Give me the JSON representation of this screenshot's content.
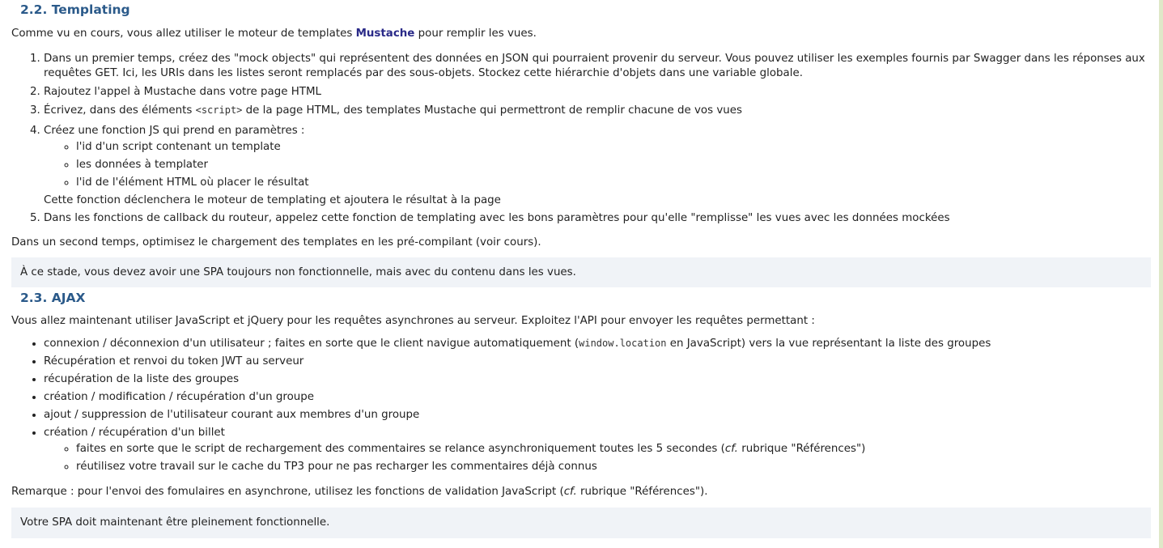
{
  "sec22": {
    "title": "2.2. Templating",
    "intro_before": "Comme vu en cours, vous allez utiliser le moteur de templates ",
    "intro_link": "Mustache",
    "intro_after": " pour remplir les vues.",
    "steps": {
      "s1": "Dans un premier temps, créez des \"mock objects\" qui représentent des données en JSON qui pourraient provenir du serveur. Vous pouvez utiliser les exemples fournis par Swagger dans les réponses aux requêtes GET. Ici, les URIs dans les listes seront remplacés par des sous-objets. Stockez cette hiérarchie d'objets dans une variable globale.",
      "s2": "Rajoutez l'appel à Mustache dans votre page HTML",
      "s3_before": "Écrivez, dans des éléments ",
      "s3_code": "<script>",
      "s3_after": " de la page HTML, des templates Mustache qui permettront de remplir chacune de vos vues",
      "s4": "Créez une fonction JS qui prend en paramètres :",
      "s4_sub": [
        "l'id d'un script contenant un template",
        "les données à templater",
        "l'id de l'élément HTML où placer le résultat"
      ],
      "s4_after": "Cette fonction déclenchera le moteur de templating et ajoutera le résultat à la page",
      "s5": "Dans les fonctions de callback du routeur, appelez cette fonction de templating avec les bons paramètres pour qu'elle \"remplisse\" les vues avec les données mockées"
    },
    "outro": "Dans un second temps, optimisez le chargement des templates en les pré-compilant (voir cours).",
    "note": "À ce stade, vous devez avoir une SPA toujours non fonctionnelle, mais avec du contenu dans les vues."
  },
  "sec23": {
    "title": "2.3. AJAX",
    "intro": "Vous allez maintenant utiliser JavaScript et jQuery pour les requêtes asynchrones au serveur. Exploitez l'API pour envoyer les requêtes permettant :",
    "items": {
      "i1_before": "connexion / déconnexion d'un utilisateur ; faites en sorte que le client navigue automatiquement (",
      "i1_code": "window.location",
      "i1_after": " en JavaScript) vers la vue représentant la liste des groupes",
      "i2": "Récupération et renvoi du token JWT au serveur",
      "i3": "récupération de la liste des groupes",
      "i4": "création / modification / récupération d'un groupe",
      "i5": "ajout / suppression de l'utilisateur courant aux membres d'un groupe",
      "i6": "création / récupération d'un billet",
      "i6_sub1_before": "faites en sorte que le script de rechargement des commentaires se relance asynchroniquement toutes les 5 secondes (",
      "i6_sub1_em": "cf.",
      "i6_sub1_after": " rubrique \"Références\")",
      "i6_sub2": "réutilisez votre travail sur le cache du TP3 pour ne pas recharger les commentaires déjà connus"
    },
    "remark_before": "Remarque : pour l'envoi des fomulaires en asynchrone, utilisez les fonctions de validation JavaScript (",
    "remark_em": "cf.",
    "remark_after": " rubrique \"Références\").",
    "note": "Votre SPA doit maintenant être pleinement fonctionnelle."
  }
}
